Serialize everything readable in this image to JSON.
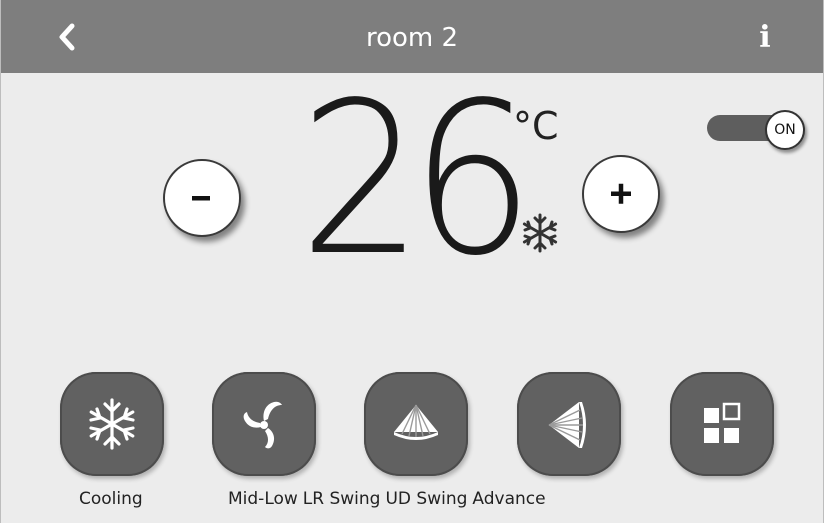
{
  "header": {
    "back_icon": "chevron-left-icon",
    "title": "room 2",
    "info_label": "i"
  },
  "temperature": {
    "value": "26",
    "unit": "°C",
    "mode_icon": "snowflake-icon"
  },
  "controls": {
    "decrease_icon": "minus-icon",
    "increase_icon": "plus-icon"
  },
  "power": {
    "state": "on",
    "label": "ON"
  },
  "functions": [
    {
      "label": "Cooling",
      "icon": "snowflake-icon"
    },
    {
      "label": "Mid-Low",
      "icon": "fan-icon"
    },
    {
      "label": "LR Swing",
      "icon": "lr-swing-icon"
    },
    {
      "label": "UD Swing",
      "icon": "ud-swing-icon"
    },
    {
      "label": "Advance",
      "icon": "advance-grid-icon"
    }
  ],
  "colors": {
    "header_bg": "#7e7e7e",
    "screen_bg": "#ececec",
    "button_bg": "#616161",
    "toggle_track": "#5e5e5e"
  }
}
